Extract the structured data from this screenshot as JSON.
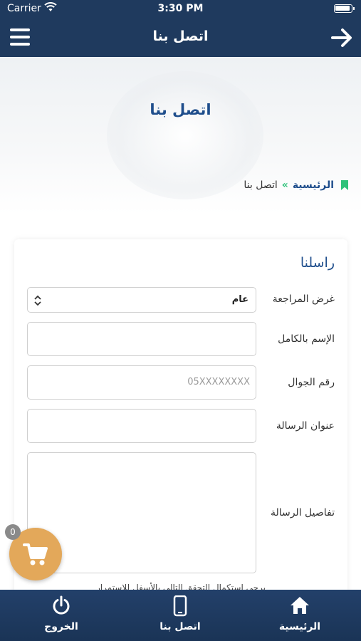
{
  "status_bar": {
    "carrier": "Carrier",
    "time": "3:30 PM"
  },
  "nav": {
    "title": "اتصل بنا",
    "menu_icon": "hamburger-icon",
    "back_icon": "arrow-right-icon"
  },
  "banner": {
    "heading": "اتصل بنا"
  },
  "breadcrumb": {
    "home": "الرئيسية",
    "separator": "»",
    "current": "اتصل بنا"
  },
  "form": {
    "title": "راسلنا",
    "purpose": {
      "label": "غرض المراجعة",
      "value": "عام"
    },
    "full_name": {
      "label": "الإسم بالكامل",
      "placeholder": ""
    },
    "mobile": {
      "label": "رقم الجوال",
      "placeholder": "05XXXXXXXX"
    },
    "subject": {
      "label": "عنوان الرسالة",
      "placeholder": ""
    },
    "details": {
      "label": "تفاصيل الرسالة",
      "placeholder": ""
    },
    "note": "يرجى استكمال التحقق التالي بالأسفل للاستمرار"
  },
  "cart": {
    "count": "0",
    "icon": "cart-icon"
  },
  "tab_bar": {
    "home": {
      "label": "الرئيسية",
      "icon": "home-icon"
    },
    "contact": {
      "label": "اتصل بنا",
      "icon": "phone-icon"
    },
    "logout": {
      "label": "الخروج",
      "icon": "power-icon"
    }
  },
  "colors": {
    "header_bg": "#1f3a5e",
    "accent_blue": "#1f4e8c",
    "accent_green": "#2fc27a",
    "cart_orange": "#e3a85a"
  }
}
